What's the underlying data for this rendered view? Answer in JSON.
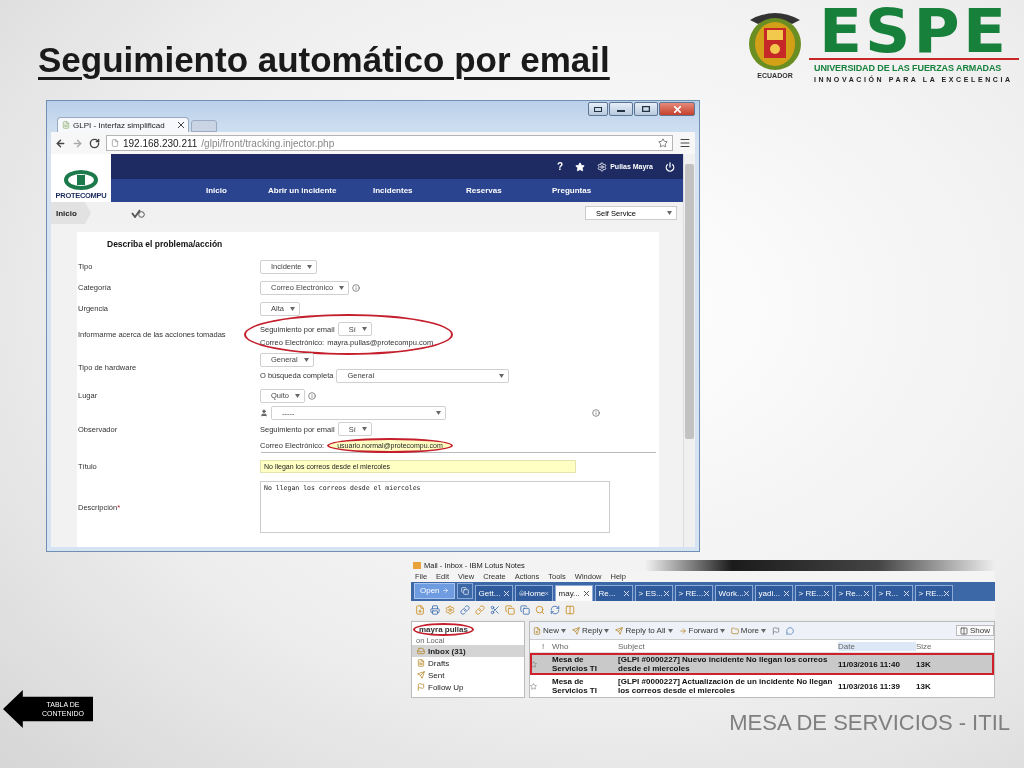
{
  "slide": {
    "title": "Seguimiento automático por email",
    "footer": "MESA DE SERVICIOS - ITIL",
    "back_button": "TABLA DE CONTENIDO"
  },
  "logo": {
    "wordmark": "ESPE",
    "line1": "UNIVERSIDAD DE LAS FUERZAS ARMADAS",
    "line2": "INNOVACIÓN PARA LA EXCELENCIA",
    "seal_caption": "ECUADOR"
  },
  "browser": {
    "tab_title": "GLPI - Interfaz simplificad",
    "url_host": "192.168.230.211",
    "url_path": "/glpi/front/tracking.injector.php",
    "app": {
      "logo_text": "PROTECOMPU",
      "help_label": "?",
      "user": "Pullas Mayra",
      "nav": [
        {
          "label": "Inicio"
        },
        {
          "label": "Abrir un incidente"
        },
        {
          "label": "Incidentes"
        },
        {
          "label": "Reservas"
        },
        {
          "label": "Preguntas"
        }
      ],
      "breadcrumb": "Inicio",
      "profile": "Self Service",
      "form": {
        "heading": "Describa el problema/acción",
        "rows": [
          {
            "kind": "select",
            "label": "Tipo",
            "value": "Incidente",
            "info": false
          },
          {
            "kind": "select",
            "label": "Categoría",
            "value": "Correo Electrónico",
            "info": true
          },
          {
            "kind": "select",
            "label": "Urgencia",
            "value": "Alta",
            "info": false
          },
          {
            "kind": "notify",
            "label": "Informarme acerca de las acciones tomadas",
            "follow_label": "Seguimiento por email",
            "follow_value": "Sí",
            "email_label": "Correo Electrónico:",
            "email": "mayra.pullas@protecompu.com",
            "circled": true
          },
          {
            "kind": "hardware",
            "label": "Tipo de hardware",
            "value": "General",
            "search_label": "O búsqueda completa",
            "search_value": "General"
          },
          {
            "kind": "select",
            "label": "Lugar",
            "value": "Quito",
            "info": true
          },
          {
            "kind": "observer",
            "label": "Observador",
            "value": "-----",
            "follow_label": "Seguimiento por email",
            "follow_value": "Sí",
            "email_label": "Correo Electrónico:",
            "email": "usuario.normal@protecompu.com",
            "circled": true
          },
          {
            "kind": "input",
            "label": "Título",
            "value": "No llegan los correos desde el miercoles"
          },
          {
            "kind": "textarea",
            "label": "Descripción",
            "required_mark": "*",
            "value": "No llegan los correos desde el miercoles"
          }
        ]
      }
    }
  },
  "mail": {
    "title": "Mail - Inbox - IBM Lotus Notes",
    "menu": [
      "File",
      "Edit",
      "View",
      "Create",
      "Actions",
      "Tools",
      "Window",
      "Help"
    ],
    "open_button": "Open",
    "tabs": [
      {
        "label": "Gett...",
        "selected": false
      },
      {
        "label": "Home",
        "selected": false
      },
      {
        "label": "may...",
        "selected": true
      },
      {
        "label": "Re...",
        "selected": false
      },
      {
        "label": "> ES...",
        "selected": false
      },
      {
        "label": "> RE...",
        "selected": false
      },
      {
        "label": "Work...",
        "selected": false
      },
      {
        "label": "yadi...",
        "selected": false
      },
      {
        "label": "> RE...",
        "selected": false
      },
      {
        "label": "> Re...",
        "selected": false
      },
      {
        "label": "> R...",
        "selected": false
      },
      {
        "label": "> RE...",
        "selected": false
      }
    ],
    "sidebar": {
      "user": "mayra pullas",
      "user_circled": true,
      "location": "on Local",
      "folders": [
        {
          "label": "Inbox (31)",
          "selected": true
        },
        {
          "label": "Drafts",
          "selected": false
        },
        {
          "label": "Sent",
          "selected": false
        },
        {
          "label": "Follow Up",
          "selected": false
        }
      ]
    },
    "actions": [
      "New",
      "Reply",
      "Reply to All",
      "Forward",
      "More"
    ],
    "show_button": "Show",
    "priority_header": "!",
    "columns": [
      "Who",
      "Subject",
      "Date",
      "Size"
    ],
    "emails": [
      {
        "who": "Mesa de Servicios TI",
        "subject": "[GLPI #0000227] Nuevo incidente No llegan los correos desde el miercoles",
        "date": "11/03/2016 11:40",
        "size": "13K",
        "selected": true,
        "circled": true
      },
      {
        "who": "Mesa de Servicios TI",
        "subject": "[GLPI #0000227] Actualización de un incidente No llegan los correos desde el miercoles",
        "date": "11/03/2016 11:39",
        "size": "13K",
        "selected": false,
        "circled": false
      }
    ]
  }
}
